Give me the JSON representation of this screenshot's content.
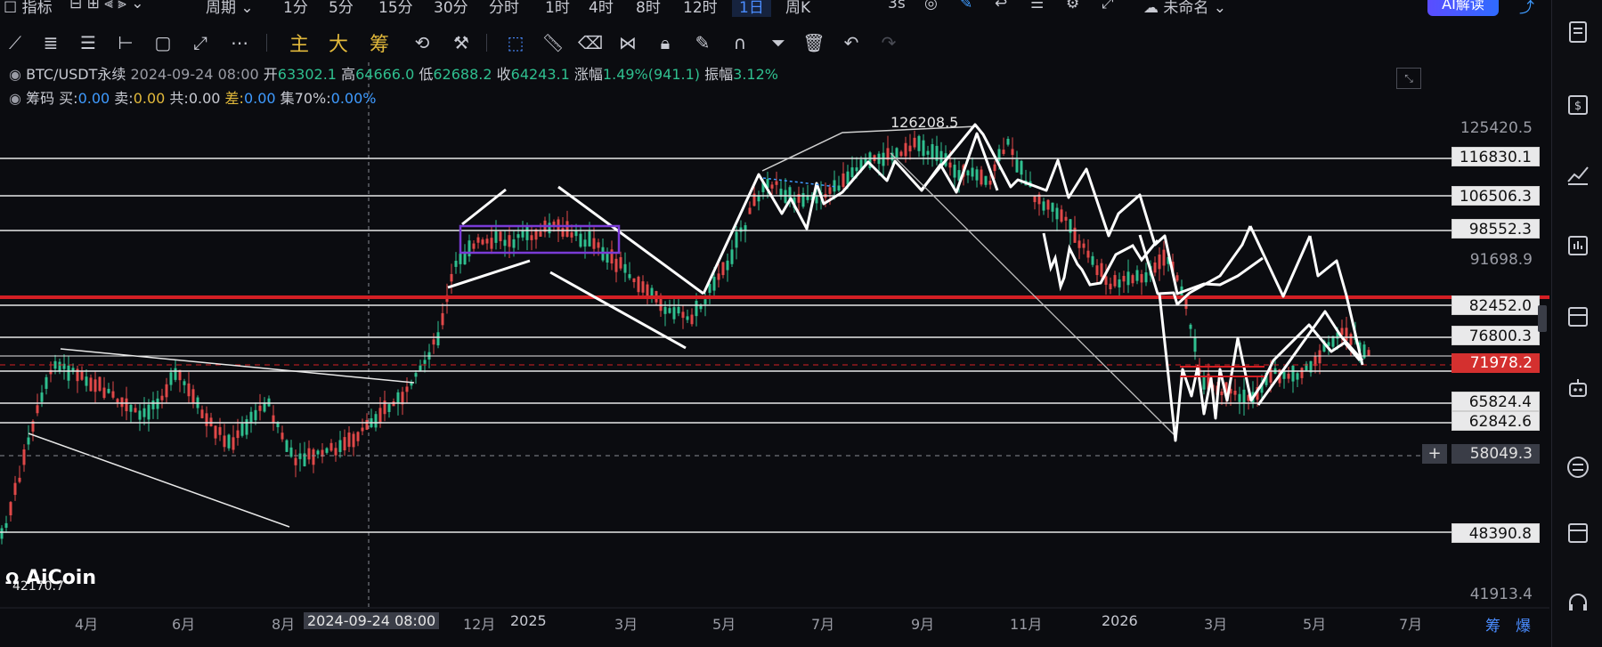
{
  "topbar": {
    "indicators_label": "指标",
    "period_label": "周期",
    "periods": [
      "1分",
      "5分",
      "15分",
      "30分",
      "分时",
      "1时",
      "4时",
      "8时",
      "12时",
      "1日",
      "周K"
    ],
    "active_period": "1日",
    "refresh": "3s",
    "layout_name": "未命名",
    "ai_button": "AI解读"
  },
  "toolbar": {
    "labels": [
      "主",
      "大",
      "筹"
    ]
  },
  "info": {
    "symbol": "BTC/USDT永续",
    "date": "2024-09-24 08:00",
    "open_label": "开",
    "open": "63302.1",
    "high_label": "高",
    "high": "64666.0",
    "low_label": "低",
    "low": "62688.2",
    "close_label": "收",
    "close": "64243.1",
    "change_label": "涨幅",
    "change": "1.49%(941.1)",
    "amp_label": "振幅",
    "amp": "3.12%"
  },
  "chips": {
    "label": "筹码",
    "buy_label": "买:",
    "buy": "0.00",
    "sell_label": "卖:",
    "sell": "0.00",
    "total_label": "共:",
    "total": "0.00",
    "diff_label": "差:",
    "diff": "0.00",
    "conc_label": "集70%:",
    "conc": "0.00%"
  },
  "price_axis": {
    "labels": [
      "125420.5",
      "116830.1",
      "106506.3",
      "98552.3",
      "91698.9",
      "82452.0",
      "76800.3",
      "71978.2",
      "65824.4",
      "62842.6",
      "58049.3",
      "48390.8",
      "41913.4"
    ],
    "current": "71978.2",
    "cursor": "58049.3"
  },
  "annotations": {
    "peak": "126208.5",
    "low": "42170.7"
  },
  "time_axis": {
    "labels": [
      "4月",
      "6月",
      "8月",
      "12月",
      "2025",
      "3月",
      "5月",
      "7月",
      "9月",
      "11月",
      "2026",
      "3月",
      "5月",
      "7月"
    ],
    "cursor": "2024-09-24 08:00",
    "corner_1": "筹",
    "corner_2": "爆"
  },
  "logo": "AiCoin",
  "colors": {
    "up": "#2fbf8f",
    "down": "#e04848",
    "accent": "#4a8cff",
    "resistance": "#d41f24",
    "channel": "#7a3bd6"
  },
  "sidebar_icons": [
    "orders-icon",
    "asset-icon",
    "trend-icon",
    "stats-icon",
    "robot-icon",
    "transfer-icon",
    "layout-icon",
    "support-icon"
  ]
}
